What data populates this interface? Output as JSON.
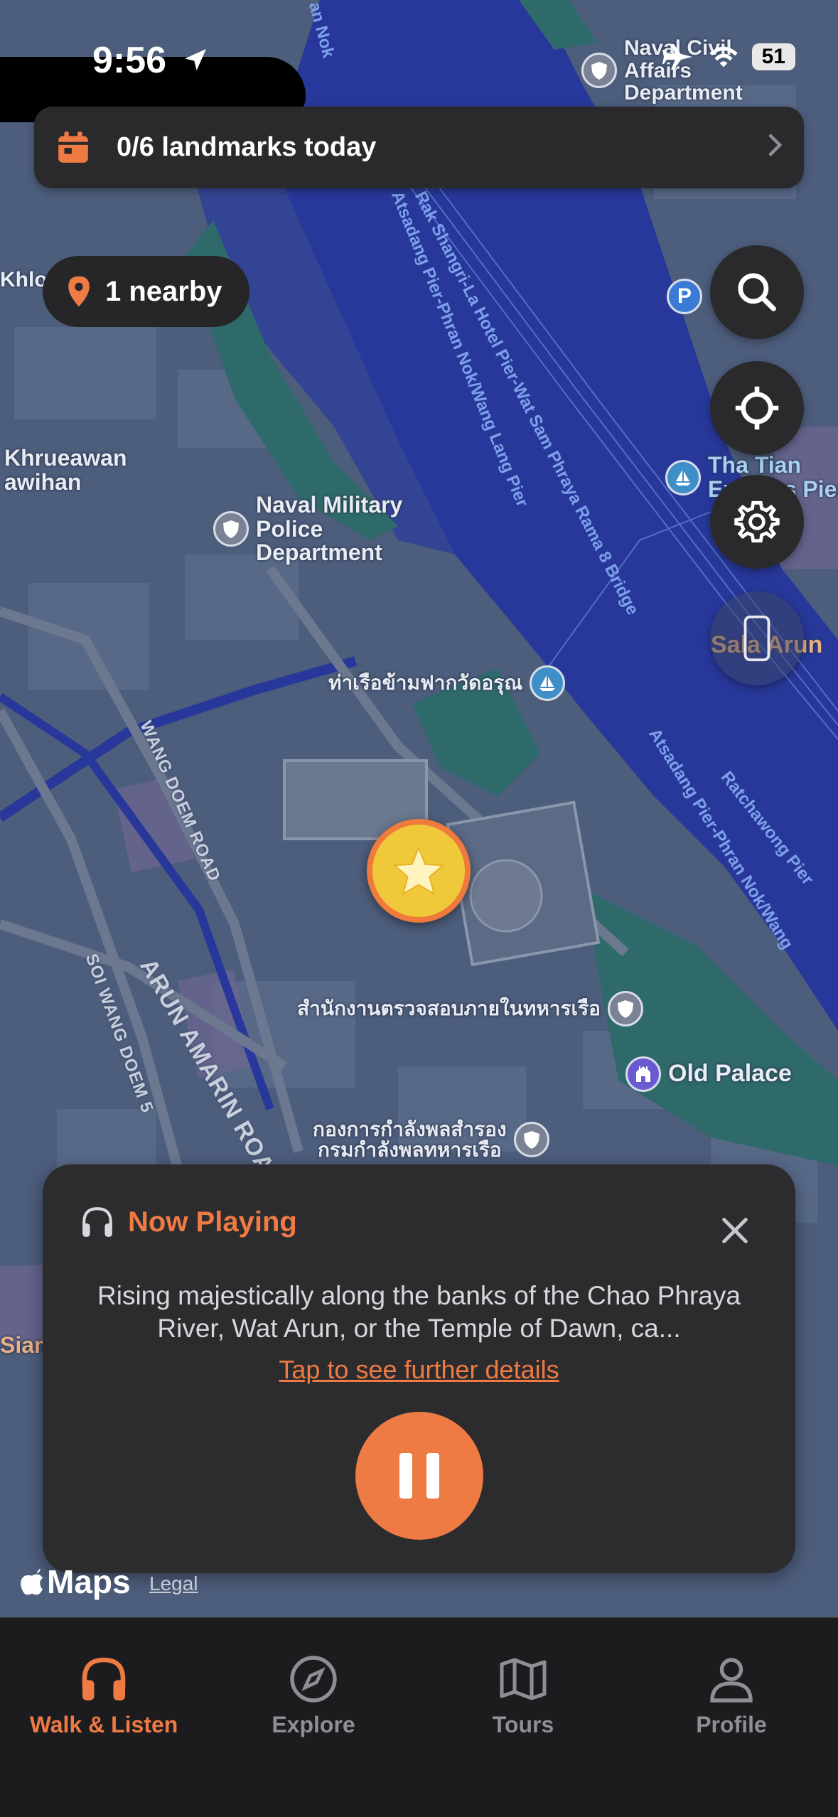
{
  "status_bar": {
    "time": "9:56",
    "battery": "51"
  },
  "banner": {
    "text": "0/6 landmarks today"
  },
  "nearby": {
    "text": "1 nearby"
  },
  "map": {
    "labels": {
      "naval_civil": "Naval Civil\nAffairs\nDepartment",
      "naval_military": "Naval Military\nPolice\nDepartment",
      "khrueawan": "Khrueawan\nawihan",
      "khlong": "Khlong Mon Pier",
      "tha_tian": "Tha Tian\nExpress Pier",
      "sala_arun": "Sala Arun",
      "pier_thai": "ท่าเรือข้ามฟากวัดอรุณ",
      "office_thai": "สำนักงานตรวจสอบภายในทหารเรือ",
      "old_palace": "Old Palace",
      "naval_force_thai": "กองการกำลังพลสำรอง\nกรมกำลังพลทหารเรือ",
      "siam": "Siam",
      "wang_doem_road": "WANG DOEM ROAD",
      "soi_wang_doem": "SOI WANG DOEM 5",
      "arun_amarin": "ARUN AMARIN ROAD",
      "water1": "Rak Shangri-La Hotel Pier-Wat Sam Phraya Rama 8 Bridge",
      "water2": "Atsadang Pier-Phran Nok/Wang Lang Pier",
      "water3": "Atsadang Pier-Phran Nok/Wang",
      "water4": "Ratchawong Pier",
      "an_nok": "an Nok"
    }
  },
  "now_playing": {
    "title": "Now Playing",
    "description": "Rising majestically along the banks of the Chao Phraya River, Wat Arun, or the Temple of Dawn, ca...",
    "link": "Tap to see further details"
  },
  "attribution": {
    "maps": "Maps",
    "legal": "Legal"
  },
  "tabs": [
    {
      "label": "Walk & Listen"
    },
    {
      "label": "Explore"
    },
    {
      "label": "Tours"
    },
    {
      "label": "Profile"
    }
  ],
  "colors": {
    "accent": "#ee7a44",
    "card": "#2c2c2e",
    "river": "#2a3a8a"
  }
}
